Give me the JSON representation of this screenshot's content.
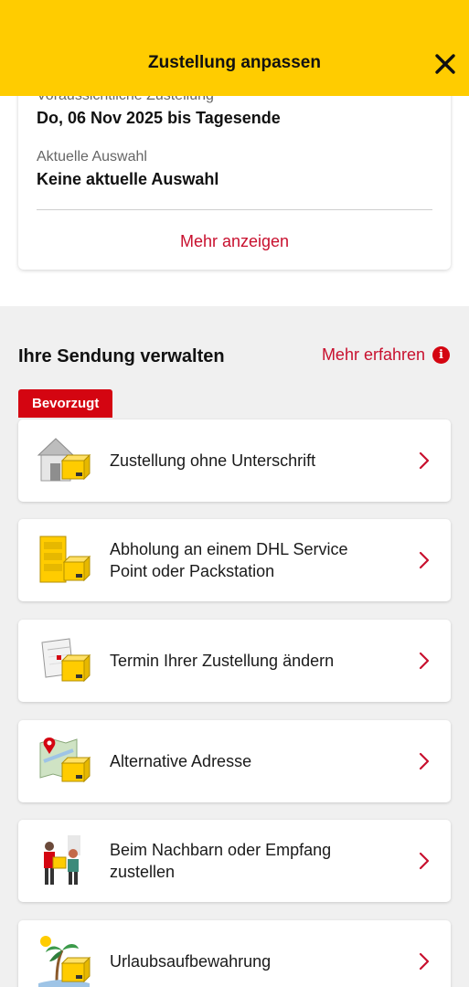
{
  "header": {
    "title": "Zustellung anpassen",
    "close_icon": "close-icon"
  },
  "delivery_info": {
    "expected_label": "Voraussichtliche Zustellung",
    "expected_value": "Do, 06 Nov 2025 bis Tagesende",
    "current_label": "Aktuelle Auswahl",
    "current_value": "Keine aktuelle Auswahl",
    "more_link": "Mehr anzeigen"
  },
  "manage": {
    "title": "Ihre Sendung verwalten",
    "learn_more": "Mehr erfahren",
    "info_icon": "i",
    "badge": "Bevorzugt",
    "options": [
      {
        "label": "Zustellung ohne Unterschrift",
        "icon": "house-with-parcel-icon"
      },
      {
        "label": "Abholung an einem DHL Service Point oder Packstation",
        "icon": "packstation-icon"
      },
      {
        "label": "Termin Ihrer Zustellung ändern",
        "icon": "calendar-parcel-icon"
      },
      {
        "label": "Alternative Adresse",
        "icon": "map-pin-parcel-icon"
      },
      {
        "label": "Beim Nachbarn oder Empfang zustellen",
        "icon": "neighbour-handover-icon"
      },
      {
        "label": "Urlaubsaufbewahrung",
        "icon": "palm-tree-parcel-icon"
      }
    ]
  },
  "colors": {
    "brand_yellow": "#ffcc00",
    "brand_red": "#d40511",
    "link_red": "#c8102e",
    "background_grey": "#f0f0f0"
  }
}
